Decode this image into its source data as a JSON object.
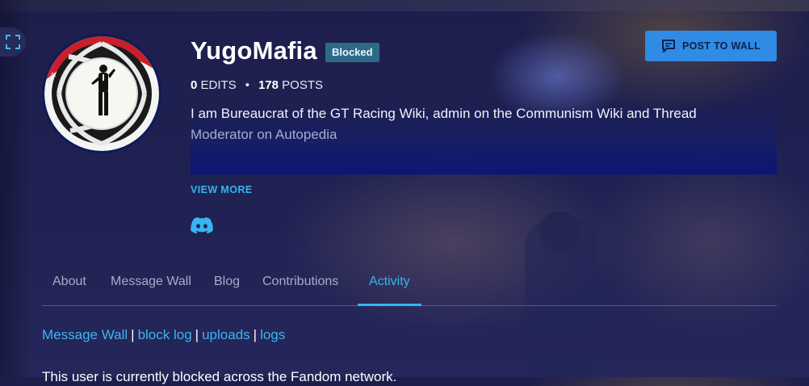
{
  "profile": {
    "username": "YugoMafia",
    "status_badge": "Blocked",
    "edits_count": "0",
    "edits_label": "EDITS",
    "posts_count": "178",
    "posts_label": "POSTS",
    "stats_separator": "•",
    "bio_line_1": "I am Bureaucrat of the GT Racing Wiki, admin on the Communism Wiki and Thread",
    "bio_line_2": "Moderator on Autopedia",
    "view_more_label": "VIEW MORE",
    "social": [
      {
        "icon": "discord-icon"
      }
    ]
  },
  "actions": {
    "post_to_wall_label": "POST TO WALL",
    "post_to_wall_icon": "message-bubble-icon",
    "expand_icon": "expand-icon"
  },
  "tabs": [
    {
      "label": "About",
      "active": false
    },
    {
      "label": "Message Wall",
      "active": false
    },
    {
      "label": "Blog",
      "active": false
    },
    {
      "label": "Contributions",
      "active": false
    },
    {
      "label": "Activity",
      "active": true
    }
  ],
  "content": {
    "links": [
      {
        "label": "Message Wall"
      },
      {
        "label": "block log"
      },
      {
        "label": "uploads"
      },
      {
        "label": "logs"
      }
    ],
    "link_separator": "|",
    "blocked_note": "This user is currently blocked across the Fandom network."
  },
  "colors": {
    "accent_link": "#35b5f2",
    "button_primary": "#2f8be4",
    "badge_blocked": "#2d6a88",
    "background": "#1f2152"
  }
}
